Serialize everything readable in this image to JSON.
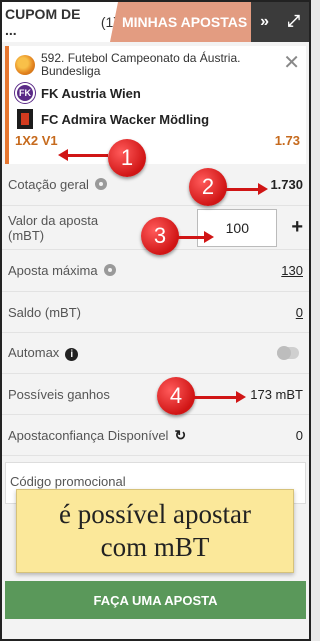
{
  "tabs": {
    "active_label": "CUPOM DE ...",
    "active_count": "(1)",
    "inactive_label": "MINHAS APOSTAS",
    "icons": [
      "double-chevron-right-icon",
      "expand-icon"
    ]
  },
  "selection": {
    "league": "592. Futebol Campeonato da Áustria. Bundesliga",
    "home_team": "FK Austria Wien",
    "away_team": "FC Admira Wacker Mödling",
    "market": "1X2 V1",
    "odd": "1.73"
  },
  "form": {
    "total_odds_label": "Cotação geral",
    "total_odds_value": "1.730",
    "stake_label": "Valor da aposta (mBT)",
    "stake_value": "100",
    "stake_plus": "+",
    "max_bet_label": "Aposta máxima",
    "max_bet_value": "130",
    "balance_label": "Saldo (mBT)",
    "balance_value": "0",
    "automax_label": "Automax",
    "winnings_label": "Possíveis ganhos",
    "winnings_value": "173 mBT",
    "confidence_label": "Apostaconfiança Disponível",
    "confidence_value": "0",
    "promo_placeholder": "Código promocional"
  },
  "cta_label": "FAÇA UMA APOSTA",
  "annotations": {
    "markers": [
      "1",
      "2",
      "3",
      "4"
    ],
    "callout_line1": "é possível apostar",
    "callout_line2": "com mBT"
  },
  "colors": {
    "accent_orange": "#e6762f",
    "tab_inactive": "#e39c81",
    "cta_green": "#5a985a",
    "marker_red": "#d01515",
    "callout_yellow": "#fbe89a"
  }
}
